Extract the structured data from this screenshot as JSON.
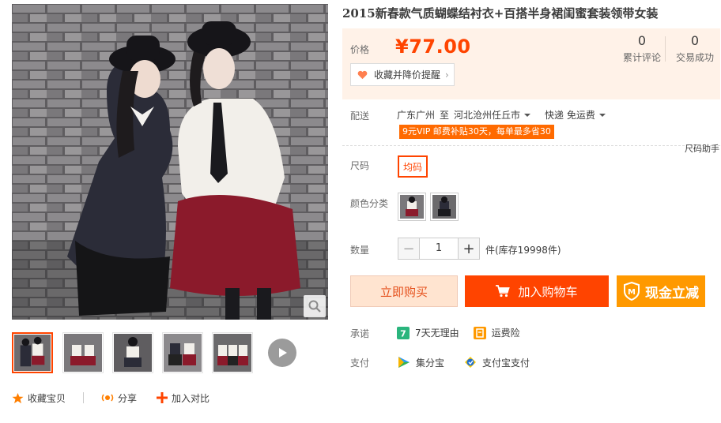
{
  "product": {
    "title": "2015新春款气质蝴蝶结衬衣+百搭半身裙闺蜜套装领带女装"
  },
  "price": {
    "label": "价格",
    "value": "¥77.00",
    "favorite_label": "收藏并降价提醒",
    "reviews_count": "0",
    "reviews_label": "累计评论",
    "sales_count": "0",
    "sales_label": "交易成功"
  },
  "shipping": {
    "label": "配送",
    "origin": "广东广州",
    "to": "至",
    "destination": "河北沧州任丘市",
    "method": "快递 免运费",
    "vip_note": "9元VIP 邮费补贴30天，每单最多省30"
  },
  "size": {
    "label": "尺码",
    "help": "尺码助手",
    "options": [
      "均码"
    ]
  },
  "color": {
    "label": "颜色分类"
  },
  "quantity": {
    "label": "数量",
    "value": "1",
    "minus": "−",
    "plus": "+",
    "stock_text": "件(库存19998件)"
  },
  "actions": {
    "buy_now": "立即购买",
    "add_to_cart": "加入购物车",
    "cash_discount": "现金立减"
  },
  "promise": {
    "label": "承诺",
    "items": [
      "7天无理由",
      "运费险"
    ]
  },
  "payment": {
    "label": "支付",
    "items": [
      "集分宝",
      "支付宝支付"
    ]
  },
  "social": {
    "favorite": "收藏宝贝",
    "share": "分享",
    "compare": "加入对比"
  },
  "colors": {
    "accent": "#ff4400",
    "price_bg": "#fff2e8",
    "cash_button": "#ff9900",
    "buy_button_bg": "#ffe4d0"
  },
  "icons": {
    "zoom": "magnifier-icon",
    "play": "play-icon",
    "cart": "cart-icon",
    "heart": "heart-icon"
  }
}
